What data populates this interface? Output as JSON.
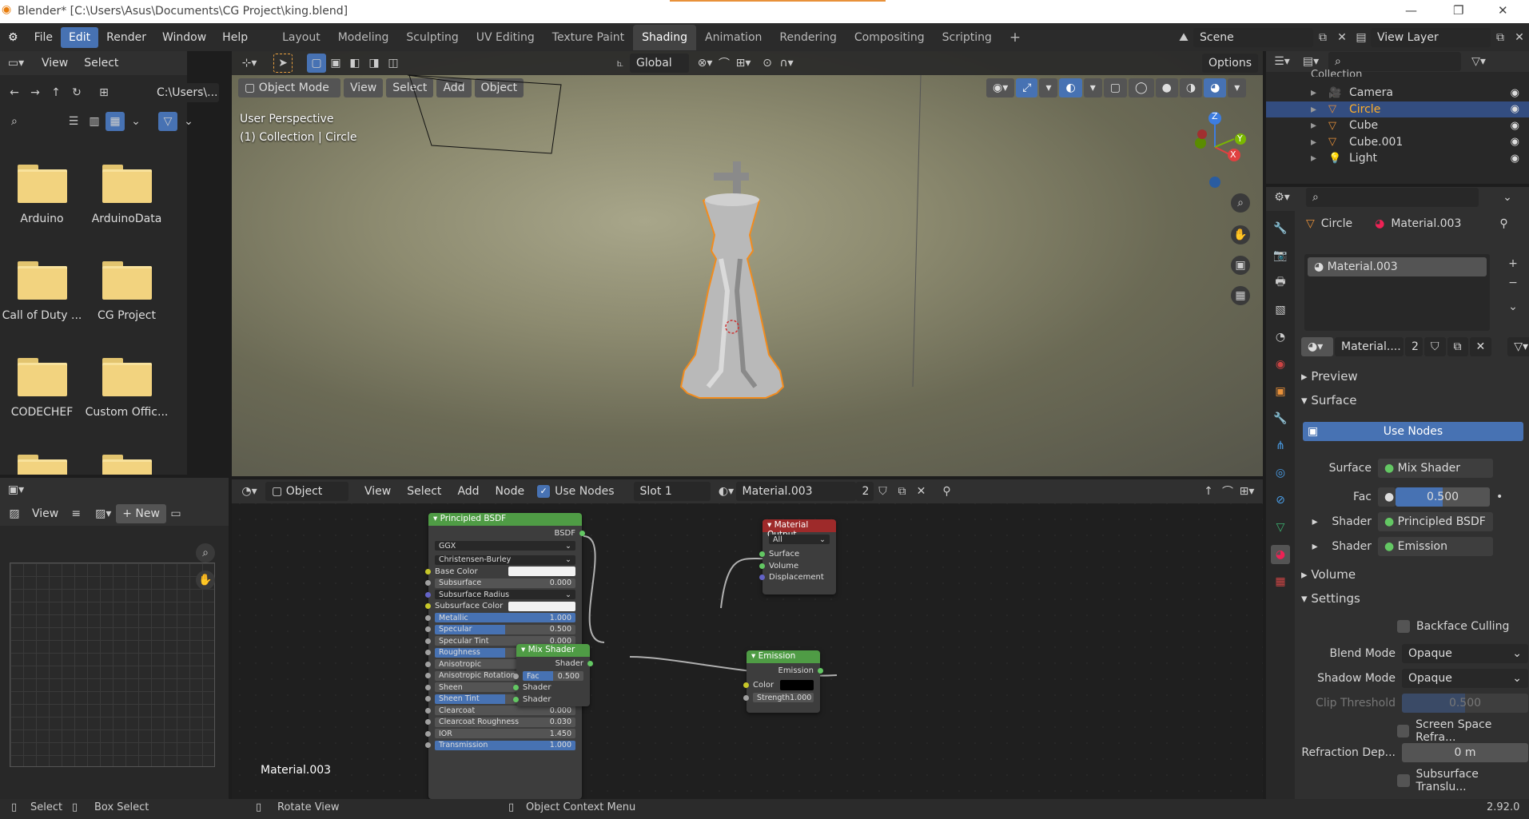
{
  "window": {
    "title": "Blender* [C:\\Users\\Asus\\Documents\\CG Project\\king.blend]"
  },
  "menu": [
    "File",
    "Edit",
    "Render",
    "Window",
    "Help"
  ],
  "menu_active": "Edit",
  "workspaces": [
    "Layout",
    "Modeling",
    "Sculpting",
    "UV Editing",
    "Texture Paint",
    "Shading",
    "Animation",
    "Rendering",
    "Compositing",
    "Scripting"
  ],
  "workspace_active": "Shading",
  "scene": "Scene",
  "view_layer": "View Layer",
  "filebrowser": {
    "view": "View",
    "select": "Select",
    "path": "C:\\Users\\...",
    "folders": [
      "Arduino",
      "ArduinoData",
      "Call of Duty ...",
      "CG Project",
      "CODECHEF",
      "Custom Offic..."
    ]
  },
  "image_editor": {
    "view": "View",
    "new": "New"
  },
  "viewport": {
    "mode": "Object Mode",
    "menus": [
      "View",
      "Select",
      "Add",
      "Object"
    ],
    "orientation": "Global",
    "options": "Options",
    "overlay_line1": "User Perspective",
    "overlay_line2": "(1) Collection | Circle",
    "axis_x": "X",
    "axis_y": "Y",
    "axis_z": "Z"
  },
  "outliner": {
    "collection": "Collection",
    "items": [
      "Camera",
      "Circle",
      "Cube",
      "Cube.001",
      "Light"
    ],
    "selected": "Circle"
  },
  "properties": {
    "object": "Circle",
    "material": "Material.003",
    "slot_item": "Material.003",
    "mat_short": "Material....",
    "users": "2",
    "preview": "Preview",
    "surface": "Surface",
    "use_nodes": "Use Nodes",
    "surface_label": "Surface",
    "surface_val": "Mix Shader",
    "fac_label": "Fac",
    "fac_val": "0.500",
    "shader_label": "Shader",
    "shader1": "Principled BSDF",
    "shader2": "Emission",
    "volume": "Volume",
    "settings": "Settings",
    "backface": "Backface Culling",
    "blend_label": "Blend Mode",
    "blend_val": "Opaque",
    "shadow_label": "Shadow Mode",
    "shadow_val": "Opaque",
    "clip_label": "Clip Threshold",
    "clip_val": "0.500",
    "ssr": "Screen Space Refra...",
    "refr_label": "Refraction Dep...",
    "refr_val": "0 m",
    "sss": "Subsurface Translu..."
  },
  "node_editor": {
    "type": "Object",
    "menus": [
      "View",
      "Select",
      "Add",
      "Node"
    ],
    "use_nodes": "Use Nodes",
    "slot": "Slot 1",
    "material": "Material.003",
    "users": "2",
    "footer": "Material.003"
  },
  "bsdf": {
    "title": "Principled BSDF",
    "out": "BSDF",
    "dist": "GGX",
    "sss_method": "Christensen-Burley",
    "rows": [
      [
        "Base Color",
        ""
      ],
      [
        "Subsurface",
        "0.000"
      ],
      [
        "Subsurface Radius",
        ""
      ],
      [
        "Subsurface Color",
        ""
      ],
      [
        "Metallic",
        "1.000"
      ],
      [
        "Specular",
        "0.500"
      ],
      [
        "Specular Tint",
        "0.000"
      ],
      [
        "Roughness",
        "0.500"
      ],
      [
        "Anisotropic",
        "0.000"
      ],
      [
        "Anisotropic Rotation",
        "0.000"
      ],
      [
        "Sheen",
        "0.000"
      ],
      [
        "Sheen Tint",
        "0.500"
      ],
      [
        "Clearcoat",
        "0.000"
      ],
      [
        "Clearcoat Roughness",
        "0.030"
      ],
      [
        "IOR",
        "1.450"
      ],
      [
        "Transmission",
        "1.000"
      ]
    ]
  },
  "mix": {
    "title": "Mix Shader",
    "out": "Shader",
    "fac": "Fac",
    "fac_val": "0.500",
    "in1": "Shader",
    "in2": "Shader"
  },
  "matout": {
    "title": "Material Output",
    "target": "All",
    "surface": "Surface",
    "volume": "Volume",
    "disp": "Displacement"
  },
  "emission": {
    "title": "Emission",
    "out": "Emission",
    "color": "Color",
    "strength": "Strength",
    "strength_val": "1.000"
  },
  "statusbar": {
    "select": "Select",
    "box": "Box Select",
    "rotate": "Rotate View",
    "ctx": "Object Context Menu",
    "version": "2.92.0"
  }
}
